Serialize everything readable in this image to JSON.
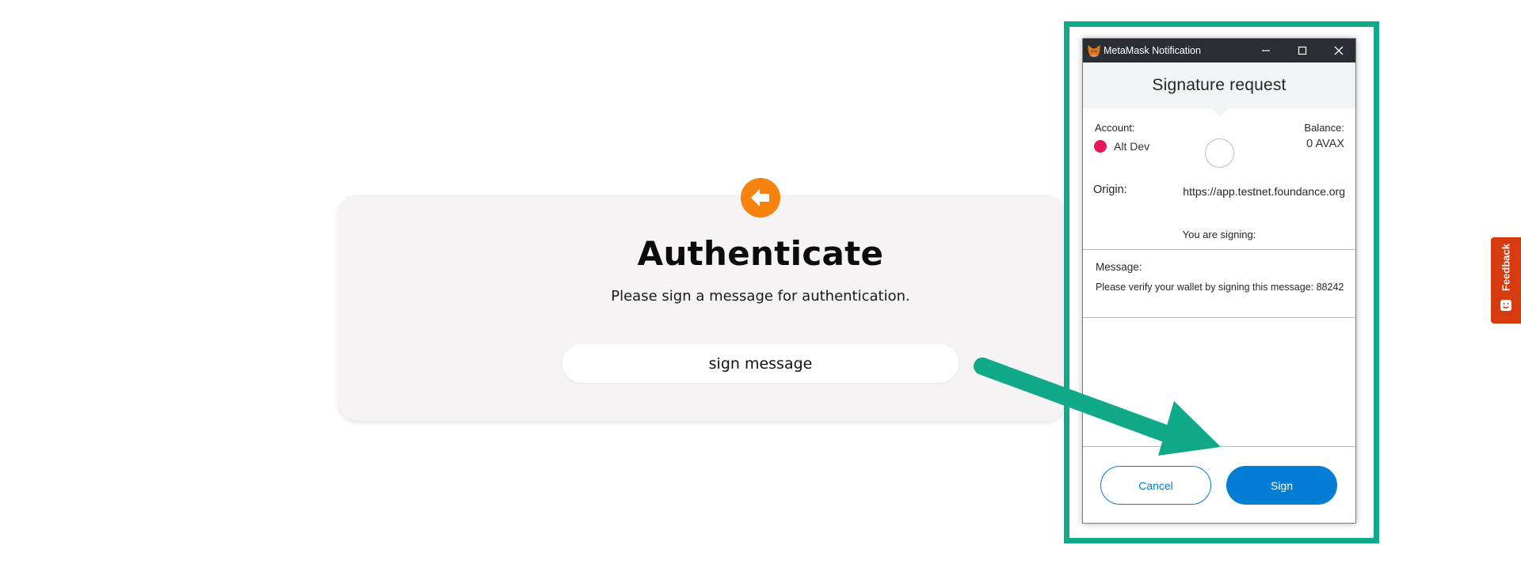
{
  "auth": {
    "title": "Authenticate",
    "subtitle": "Please sign a message for authentication.",
    "button_label": "sign message"
  },
  "metamask": {
    "window_title": "MetaMask Notification",
    "header_title": "Signature request",
    "account_label": "Account:",
    "account_name": "Alt Dev",
    "balance_label": "Balance:",
    "balance_value": "0 AVAX",
    "origin_label": "Origin:",
    "origin_value": "https://app.testnet.foundance.org",
    "signing_label": "You are signing:",
    "message_label": "Message:",
    "message_text": "Please verify your wallet by signing this message: 88242",
    "cancel_label": "Cancel",
    "sign_label": "Sign"
  },
  "feedback": {
    "label": "Feedback"
  },
  "colors": {
    "brand_orange": "#f7830e",
    "highlight_teal": "#10a98a",
    "metamask_blue": "#037dd6",
    "account_pink": "#e8175d",
    "feedback_red": "#d63b0f"
  },
  "icons": {
    "back": "arrow-left-icon",
    "fox": "metamask-fox-icon",
    "minimize": "minimize-icon",
    "maximize": "maximize-icon",
    "close": "close-icon",
    "feedback": "feedback-smile-icon"
  }
}
